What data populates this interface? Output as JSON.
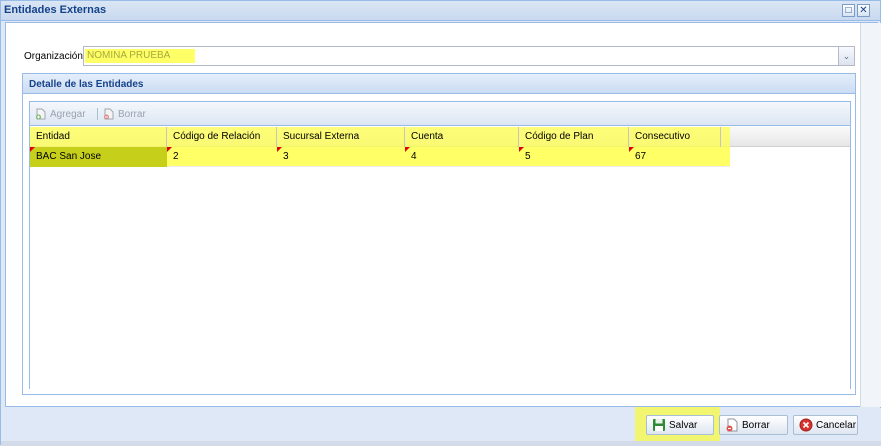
{
  "window": {
    "title": "Entidades Externas",
    "max_glyph": "□",
    "close_glyph": "✕"
  },
  "org": {
    "label": "Organización",
    "value": "NOMINA PRUEBA",
    "trigger_glyph": "⌄"
  },
  "details": {
    "title": "Detalle de las Entidades",
    "toolbar": {
      "add_label": "Agregar",
      "delete_label": "Borrar",
      "add_icon": "add-document-icon",
      "delete_icon": "delete-document-icon"
    },
    "columns": [
      "Entidad",
      "Código de Relación",
      "Sucursal Externa",
      "Cuenta",
      "Código de Plan",
      "Consecutivo"
    ],
    "rows": [
      [
        "BAC San Jose",
        "2",
        "3",
        "4",
        "5",
        "67"
      ]
    ]
  },
  "buttons": {
    "save": "Salvar",
    "delete": "Borrar",
    "cancel": "Cancelar",
    "save_icon": "floppy-disk-icon",
    "delete_icon": "delete-document-icon",
    "cancel_icon": "cancel-icon"
  },
  "colors": {
    "highlight": "#ffff00",
    "title": "#15428b",
    "border": "#99bbe8"
  }
}
